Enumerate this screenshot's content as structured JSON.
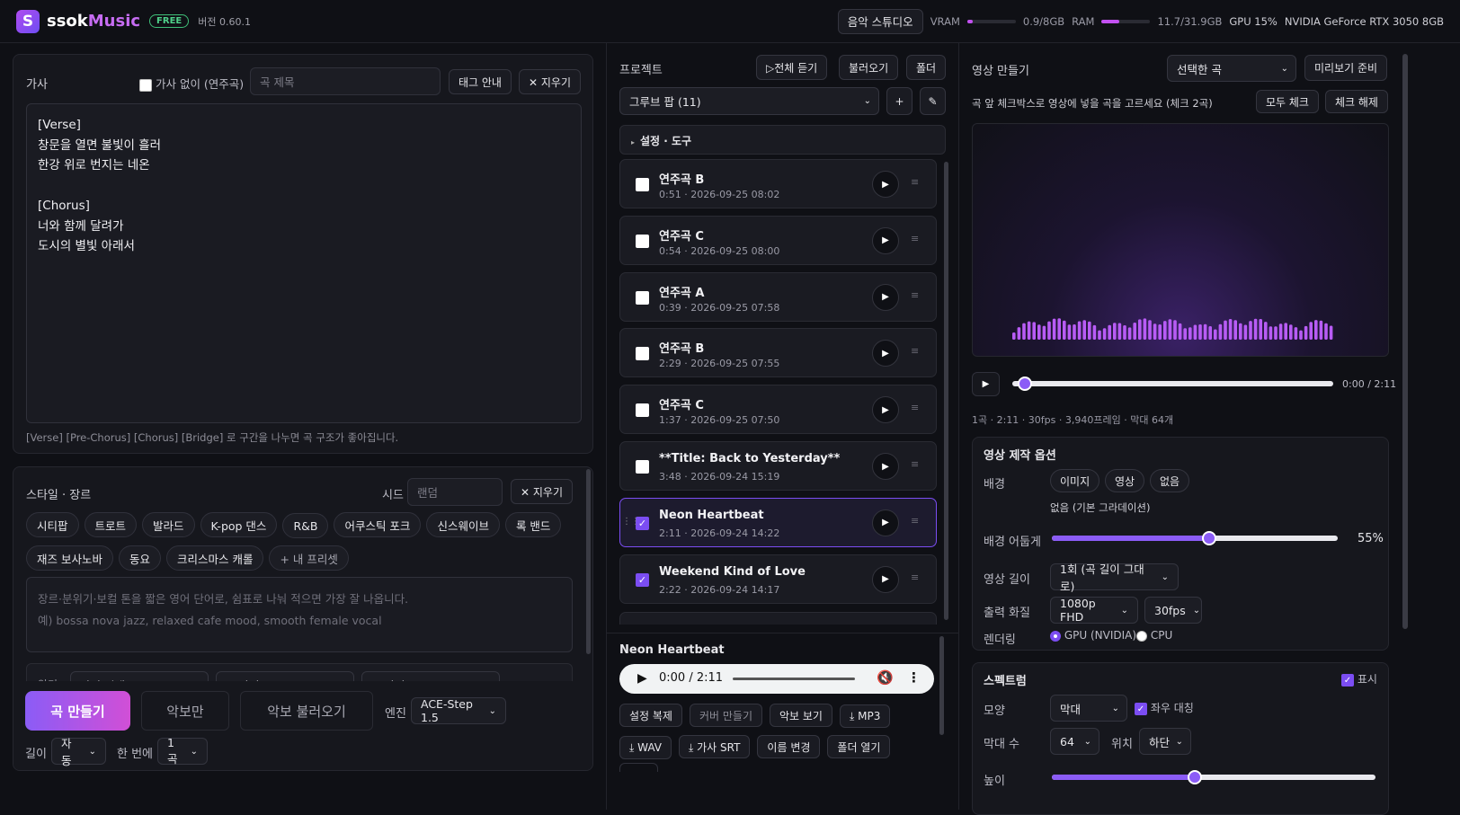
{
  "header": {
    "logo_letter": "S",
    "brand_a": "ssok",
    "brand_b": "Music",
    "badge": "FREE",
    "version": "버전 0.60.1",
    "studio_button": "음악 스튜디오",
    "vram_label": "VRAM",
    "vram_value": "0.9/8GB",
    "vram_fraction": 0.11,
    "ram_label": "RAM",
    "ram_value": "11.7/31.9GB",
    "ram_fraction": 0.37,
    "gpu_usage": "GPU 15%",
    "gpu_name": "NVIDIA GeForce RTX 3050 8GB"
  },
  "lyrics": {
    "title": "가사",
    "instrumental_label": "가사 없이 (연주곡)",
    "instrumental_checked": false,
    "title_placeholder": "곡 제목",
    "tag_guide": "태그 안내",
    "clear": "✕ 지우기",
    "text": "[Verse]\n창문을 열면 불빛이 흘러\n한강 위로 번지는 네온\n\n[Chorus]\n너와 함께 달려가\n도시의 별빛 아래서",
    "hint": "[Verse] [Pre-Chorus] [Chorus] [Bridge] 로 구간을 나누면 곡 구조가 좋아집니다."
  },
  "style": {
    "title": "스타일 · 장르",
    "seed_label": "시드",
    "seed_placeholder": "랜덤",
    "clear": "✕ 지우기",
    "chips": [
      "시티팝",
      "트로트",
      "발라드",
      "K-pop 댄스",
      "R&B",
      "어쿠스틱 포크",
      "신스웨이브",
      "록 밴드",
      "재즈 보사노바",
      "동요",
      "크리스마스 캐롤"
    ],
    "my_preset": "+ 내 프리셋",
    "placeholder_line1": "장르·분위기·보컬 톤을 짧은 영어 단어로, 쉼표로 나눠 적으면 가장 잘 나옵니다.",
    "placeholder_line2": "예) bossa nova jazz, relaxed cafe mood, smooth female vocal",
    "partial_label": "악기",
    "partial_sel1": "악기 선택",
    "partial_sel2": "+ 악기",
    "partial_sel3": "+ 악기"
  },
  "actions": {
    "make": "곡 만들기",
    "score_only": "악보만",
    "load_score": "악보 불러오기",
    "engine_label": "엔진",
    "engine": "ACE-Step 1.5",
    "length_label": "길이",
    "length": "자동",
    "batch_label": "한 번에",
    "batch": "1곡"
  },
  "project": {
    "title": "프로젝트",
    "play_all": "▷전체 듣기",
    "load": "불러오기",
    "folder": "폴더",
    "playlist": "그루브 팝 (11)",
    "add": "+",
    "edit": "✎",
    "settings": "설정 · 도구",
    "songs": [
      {
        "title": "연주곡 B",
        "meta": "0:51 · 2026-09-25 08:02",
        "checked": false
      },
      {
        "title": "연주곡 C",
        "meta": "0:54 · 2026-09-25 08:00",
        "checked": false
      },
      {
        "title": "연주곡 A",
        "meta": "0:39 · 2026-09-25 07:58",
        "checked": false
      },
      {
        "title": "연주곡 B",
        "meta": "2:29 · 2026-09-25 07:55",
        "checked": false
      },
      {
        "title": "연주곡 C",
        "meta": "1:37 · 2026-09-25 07:50",
        "checked": false
      },
      {
        "title": "**Title: Back to Yesterday**",
        "meta": "3:48 · 2026-09-24 15:19",
        "checked": false
      },
      {
        "title": "Neon Heartbeat",
        "meta": "2:11 · 2026-09-24 14:22",
        "checked": true
      },
      {
        "title": "Weekend Kind of Love",
        "meta": "2:22 · 2026-09-24 14:17",
        "checked": true
      }
    ]
  },
  "player": {
    "now_title": "Neon Heartbeat",
    "time": "0:00 / 2:11",
    "buttons": [
      "설정 복제",
      "커버 만들기",
      "악보 보기",
      "⤓ MP3",
      "⤓ WAV",
      "⤓ 가사 SRT",
      "이름 변경",
      "폴더 열기"
    ]
  },
  "video": {
    "title": "영상 만들기",
    "source": "선택한 곡",
    "preview": "미리보기 준비",
    "instruction": "곡 앞 체크박스로 영상에 넣을 곡을 고르세요 (체크 2곡)",
    "check_all": "모두 체크",
    "uncheck": "체크 해제",
    "time": "0:00 / 2:11",
    "progress": 0.0,
    "info": "1곡 · 2:11 · 30fps · 3,940프레임 · 막대 64개",
    "options_title": "영상 제작 옵션",
    "bg_label": "배경",
    "bg_opts": [
      "이미지",
      "영상",
      "없음"
    ],
    "bg_note": "없음 (기본 그라데이션)",
    "dark_label": "배경 어둡게",
    "dark_value": "55%",
    "dark_fraction": 0.55,
    "length_label": "영상 길이",
    "length": "1회 (곡 길이 그대로)",
    "quality_label": "출력 화질",
    "quality": "1080p FHD",
    "fps": "30fps",
    "render_label": "렌더링",
    "gpu": "GPU (NVIDIA)",
    "cpu": "CPU",
    "spectrum_title": "스펙트럼",
    "show_label": "표시",
    "shape_label": "모양",
    "shape": "막대",
    "mirror_label": "좌우 대칭",
    "bars_label": "막대 수",
    "bars": "64",
    "pos_label": "위치",
    "pos": "하단",
    "height_label": "높이"
  }
}
